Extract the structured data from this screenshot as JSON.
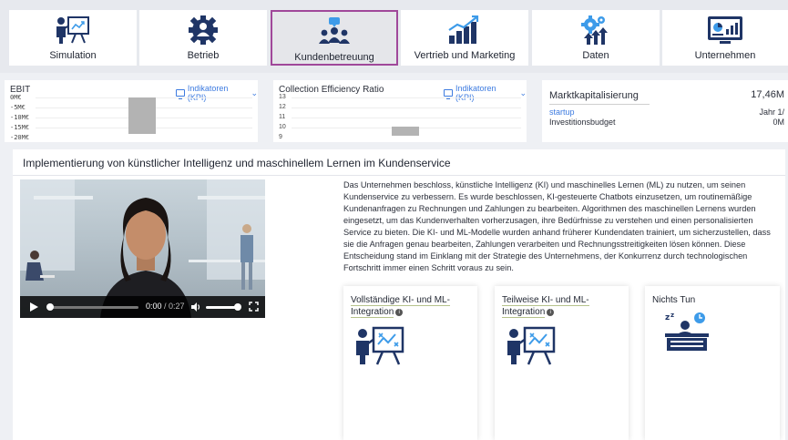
{
  "nav": [
    {
      "label": "Simulation",
      "icon": "presenter-board-icon",
      "active": false
    },
    {
      "label": "Betrieb",
      "icon": "gear-user-icon",
      "active": false
    },
    {
      "label": "Kundenbetreuung",
      "icon": "customer-group-icon",
      "active": true
    },
    {
      "label": "Vertrieb und Marketing",
      "icon": "growth-chart-icon",
      "active": false
    },
    {
      "label": "Daten",
      "icon": "gears-arrows-icon",
      "active": false
    },
    {
      "label": "Unternehmen",
      "icon": "dashboard-screen-icon",
      "active": false
    }
  ],
  "kpi": {
    "ebit": {
      "title": "EBIT",
      "dropdown": "Indikatoren (KPI)",
      "ticks": [
        "0M€",
        "-5M€",
        "-10M€",
        "-15M€",
        "-20M€"
      ]
    },
    "cer": {
      "title": "Collection Efficiency Ratio",
      "dropdown": "Indikatoren (KPI)",
      "ticks": [
        "13",
        "12",
        "11",
        "10",
        "9"
      ]
    },
    "market": {
      "title": "Marktkapitalisierung",
      "value": "17,46M",
      "link": "startup",
      "meta": "Investitionsbudget",
      "right1": "Jahr 1/",
      "right2": "0M"
    }
  },
  "main": {
    "title": "Implementierung von künstlicher Intelligenz und maschinellem Lernen im Kundenservice",
    "description": "Das Unternehmen beschloss, künstliche Intelligenz (KI) und maschinelles Lernen (ML) zu nutzen, um seinen Kundenservice zu verbessern. Es wurde beschlossen, KI-gesteuerte Chatbots einzusetzen, um routinemäßige Kundenanfragen zu Rechnungen und Zahlungen zu bearbeiten. Algorithmen des maschinellen Lernens wurden eingesetzt, um das Kundenverhalten vorherzusagen, ihre Bedürfnisse zu verstehen und einen personalisierten Service zu bieten. Die KI- und ML-Modelle wurden anhand früherer Kundendaten trainiert, um sicherzustellen, dass sie die Anfragen genau bearbeiten, Zahlungen verarbeiten und Rechnungsstreitigkeiten lösen können. Diese Entscheidung stand im Einklang mit der Strategie des Unternehmens, der Konkurrenz durch technologischen Fortschritt immer einen Schritt voraus zu sein.",
    "video": {
      "time_current": "0:00",
      "time_total": "/ 0:27"
    },
    "options": [
      {
        "line1": "Vollständige KI- und ML-",
        "line2": "Integration",
        "info": "i",
        "icon": "presenter-board-icon"
      },
      {
        "line1": "Teilweise KI- und ML-",
        "line2": "Integration",
        "info": "i",
        "icon": "presenter-board-icon"
      },
      {
        "line1": "Nichts Tun",
        "line2": "",
        "info": "",
        "icon": "sleeping-desk-icon"
      }
    ]
  },
  "colors": {
    "accent": "#a0489a",
    "navy": "#1f3566",
    "link": "#3d7be0",
    "bar": "#b3b3b3"
  }
}
